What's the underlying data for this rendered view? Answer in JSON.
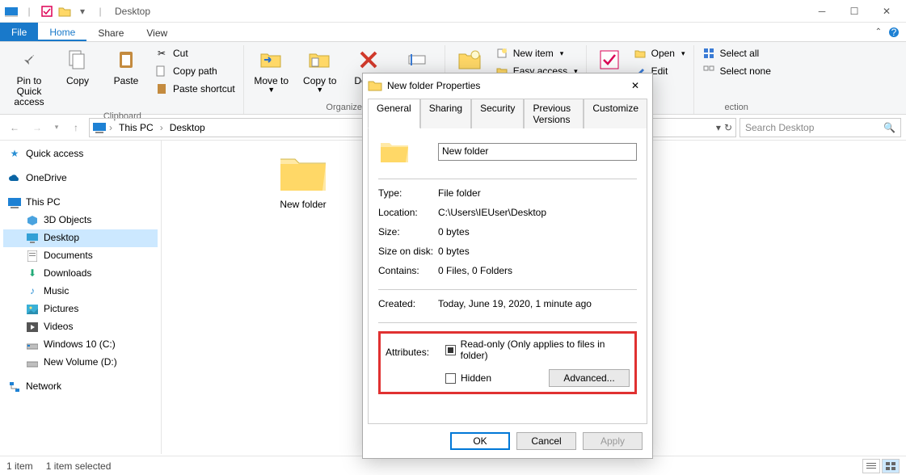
{
  "window": {
    "title": "Desktop"
  },
  "tabs": {
    "file": "File",
    "home": "Home",
    "share": "Share",
    "view": "View"
  },
  "ribbon": {
    "clipboard": {
      "label": "Clipboard",
      "pin": "Pin to Quick access",
      "copy": "Copy",
      "paste": "Paste",
      "cut": "Cut",
      "copypath": "Copy path",
      "pasteshort": "Paste shortcut"
    },
    "organize": {
      "label": "Organize",
      "moveto": "Move to",
      "copyto": "Copy to",
      "delete": "Delete",
      "rename": "Rename"
    },
    "new": {
      "newitem": "New item",
      "easyaccess": "Easy access"
    },
    "open": {
      "open": "Open",
      "edit": "Edit"
    },
    "select": {
      "selectall": "Select all",
      "selectnone": "Select none"
    }
  },
  "breadcrumb": {
    "root": "This PC",
    "leaf": "Desktop"
  },
  "search": {
    "placeholder": "Search Desktop"
  },
  "nav": {
    "quick": "Quick access",
    "onedrive": "OneDrive",
    "thispc": "This PC",
    "objects3d": "3D Objects",
    "desktop": "Desktop",
    "documents": "Documents",
    "downloads": "Downloads",
    "music": "Music",
    "pictures": "Pictures",
    "videos": "Videos",
    "cdrive": "Windows 10 (C:)",
    "ddrive": "New Volume (D:)",
    "network": "Network"
  },
  "file_item": "New folder",
  "status": {
    "count": "1 item",
    "selected": "1 item selected"
  },
  "dialog": {
    "title": "New folder Properties",
    "tabs": [
      "General",
      "Sharing",
      "Security",
      "Previous Versions",
      "Customize"
    ],
    "name": "New folder",
    "rows": {
      "type_l": "Type:",
      "type_v": "File folder",
      "loc_l": "Location:",
      "loc_v": "C:\\Users\\IEUser\\Desktop",
      "size_l": "Size:",
      "size_v": "0 bytes",
      "disk_l": "Size on disk:",
      "disk_v": "0 bytes",
      "cont_l": "Contains:",
      "cont_v": "0 Files, 0 Folders",
      "created_l": "Created:",
      "created_v": "Today, June 19, 2020, 1 minute ago",
      "attr_l": "Attributes:",
      "readonly": "Read-only (Only applies to files in folder)",
      "hidden": "Hidden",
      "advanced": "Advanced..."
    },
    "buttons": {
      "ok": "OK",
      "cancel": "Cancel",
      "apply": "Apply"
    }
  }
}
